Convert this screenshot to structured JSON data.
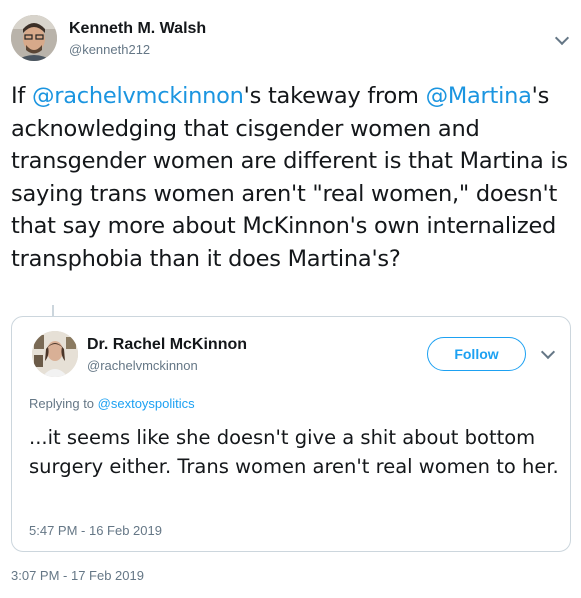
{
  "tweet": {
    "author_name": "Kenneth M. Walsh",
    "author_handle": "@kenneth212",
    "text_parts": {
      "p1": "If ",
      "m1": "@rachelvmckinnon",
      "p2": "'s takeway from ",
      "m2": "@Martina",
      "p3": "'s acknowledging that cisgender women and transgender women are different is that Martina is saying trans women aren't \"real women,\" doesn't that say more about McKinnon's own internalized transphobia than it does Martina's?"
    },
    "timestamp": "3:07 PM - 17 Feb 2019"
  },
  "quoted": {
    "author_name": "Dr. Rachel McKinnon",
    "author_handle": "@rachelvmckinnon",
    "follow_label": "Follow",
    "replying_prefix": "Replying to ",
    "replying_to": "@sextoyspolitics",
    "text": "...it seems like she doesn't give a shit about bottom surgery either. Trans women aren't real women to her.",
    "timestamp": "5:47 PM - 16 Feb 2019"
  },
  "icons": {
    "more": "chevron-down-icon"
  },
  "colors": {
    "link": "#1b95e0",
    "follow": "#1da1f2",
    "secondary": "#657786",
    "border": "#ccd6dd"
  }
}
